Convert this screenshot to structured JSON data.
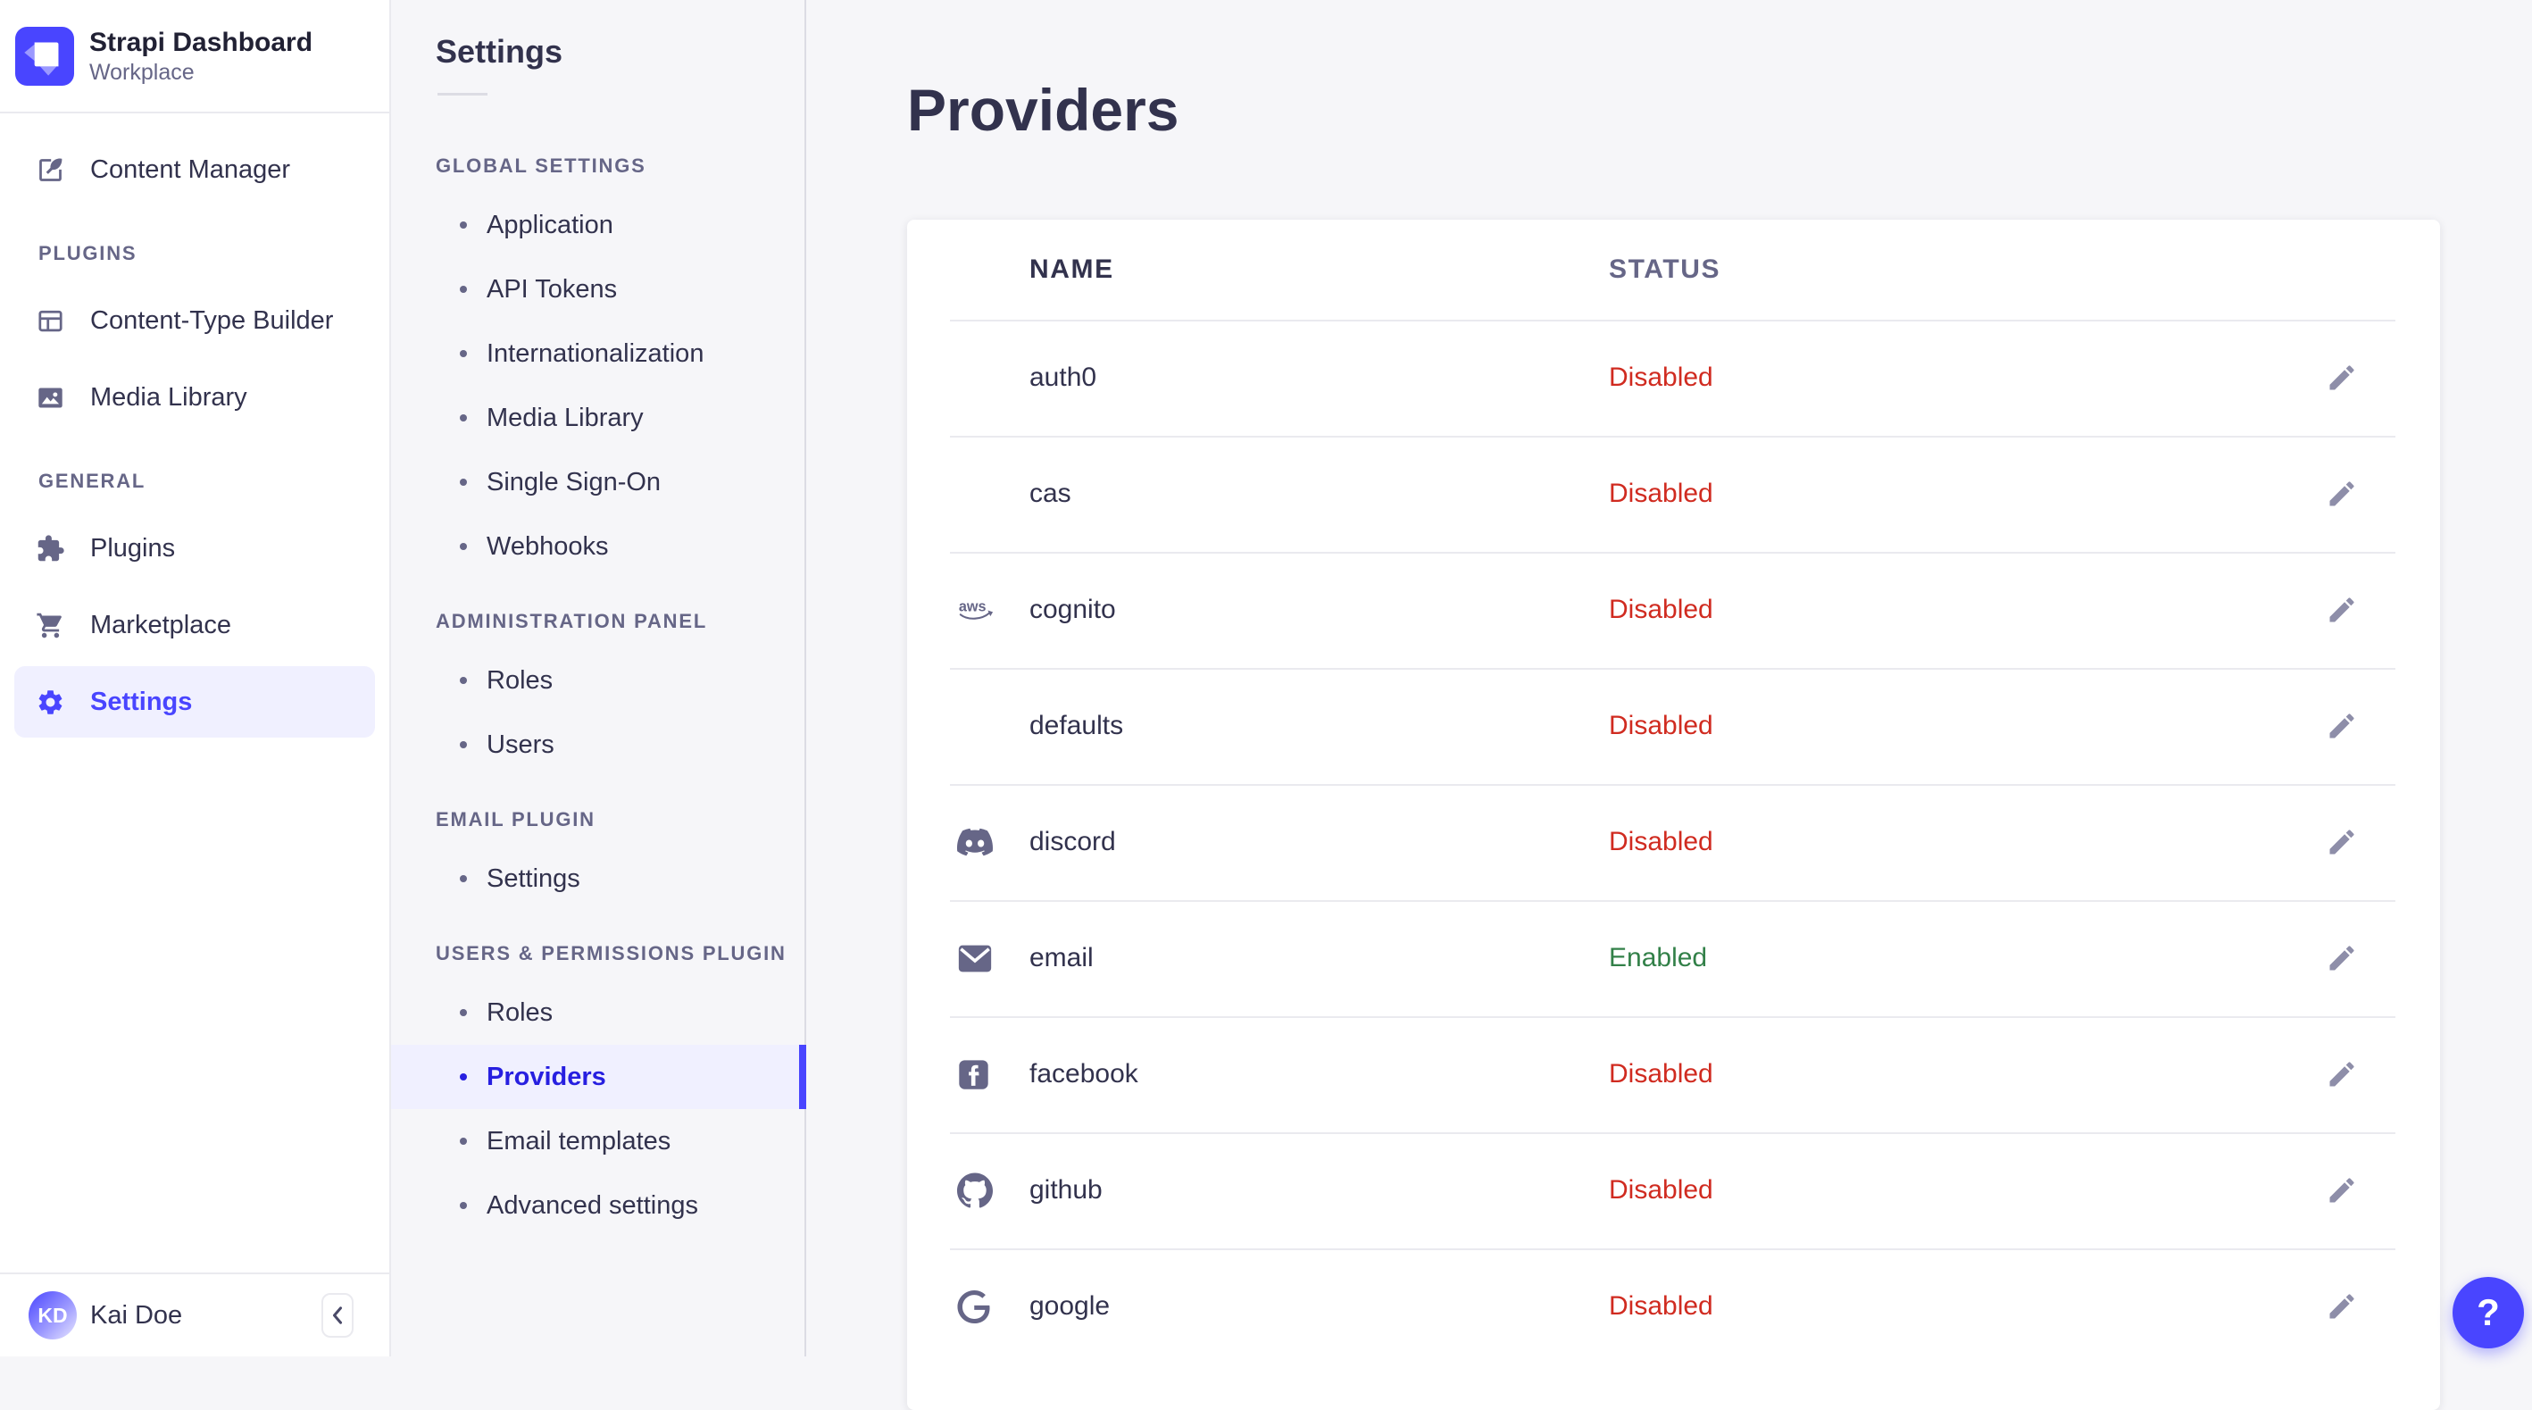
{
  "brand": {
    "app_name": "Strapi Dashboard",
    "workspace": "Workplace",
    "logo_icon": "strapi-logo"
  },
  "main_nav": {
    "top_items": [
      {
        "label": "Content Manager",
        "icon": "feather",
        "active": false
      }
    ],
    "sections": [
      {
        "label": "PLUGINS",
        "items": [
          {
            "label": "Content-Type Builder",
            "icon": "layout",
            "active": false
          },
          {
            "label": "Media Library",
            "icon": "image",
            "active": false
          }
        ]
      },
      {
        "label": "GENERAL",
        "items": [
          {
            "label": "Plugins",
            "icon": "puzzle",
            "active": false
          },
          {
            "label": "Marketplace",
            "icon": "cart",
            "active": false
          },
          {
            "label": "Settings",
            "icon": "gear",
            "active": true
          }
        ]
      }
    ],
    "user": {
      "initials": "KD",
      "name": "Kai Doe"
    },
    "collapse_icon": "chevron-left"
  },
  "subnav": {
    "title": "Settings",
    "sections": [
      {
        "label": "GLOBAL SETTINGS",
        "items": [
          {
            "label": "Application",
            "active": false
          },
          {
            "label": "API Tokens",
            "active": false
          },
          {
            "label": "Internationalization",
            "active": false
          },
          {
            "label": "Media Library",
            "active": false
          },
          {
            "label": "Single Sign-On",
            "active": false
          },
          {
            "label": "Webhooks",
            "active": false
          }
        ]
      },
      {
        "label": "ADMINISTRATION PANEL",
        "items": [
          {
            "label": "Roles",
            "active": false
          },
          {
            "label": "Users",
            "active": false
          }
        ]
      },
      {
        "label": "EMAIL PLUGIN",
        "items": [
          {
            "label": "Settings",
            "active": false
          }
        ]
      },
      {
        "label": "USERS & PERMISSIONS PLUGIN",
        "items": [
          {
            "label": "Roles",
            "active": false
          },
          {
            "label": "Providers",
            "active": true
          },
          {
            "label": "Email templates",
            "active": false
          },
          {
            "label": "Advanced settings",
            "active": false
          }
        ]
      }
    ]
  },
  "page": {
    "title": "Providers"
  },
  "table": {
    "columns": [
      "NAME",
      "STATUS"
    ],
    "rows": [
      {
        "name": "auth0",
        "status": "Disabled",
        "icon": "none"
      },
      {
        "name": "cas",
        "status": "Disabled",
        "icon": "none"
      },
      {
        "name": "cognito",
        "status": "Disabled",
        "icon": "aws"
      },
      {
        "name": "defaults",
        "status": "Disabled",
        "icon": "none"
      },
      {
        "name": "discord",
        "status": "Disabled",
        "icon": "discord"
      },
      {
        "name": "email",
        "status": "Enabled",
        "icon": "email"
      },
      {
        "name": "facebook",
        "status": "Disabled",
        "icon": "facebook"
      },
      {
        "name": "github",
        "status": "Disabled",
        "icon": "github"
      },
      {
        "name": "google",
        "status": "Disabled",
        "icon": "google"
      }
    ],
    "edit_icon": "pencil"
  },
  "help": {
    "label": "?"
  },
  "colors": {
    "primary": "#4945ff",
    "primary_light": "#f0f0ff",
    "active_link": "#271fe0",
    "danger": "#d02b20",
    "success": "#328048",
    "text": "#32324d",
    "text_muted": "#666687",
    "page_bg": "#f6f6f9"
  }
}
